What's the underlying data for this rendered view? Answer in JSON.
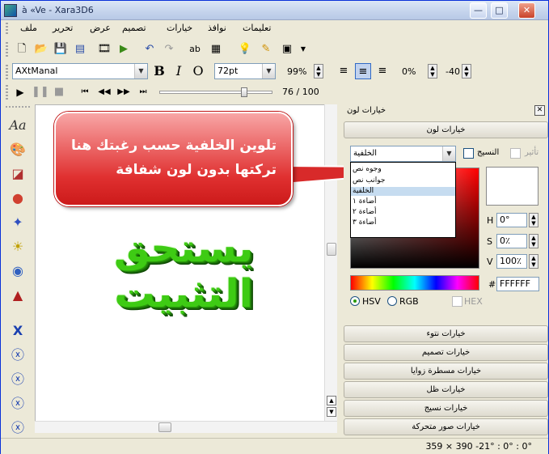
{
  "window": {
    "title": "à «Ve - Xara3D6"
  },
  "menu": {
    "items": [
      "ملف",
      "تحرير",
      "عرض",
      "تصميم",
      "خيارات",
      "نوافذ",
      "تعليمات"
    ]
  },
  "font_toolbar": {
    "font_name": "AXtManal",
    "bold": "B",
    "italic": "I",
    "outline": "O",
    "font_size": "72pt",
    "scale": "99%",
    "spacing": "0%",
    "offset": "-40"
  },
  "animation_toolbar": {
    "frame_counter": "76 / 100",
    "progress": 0.76
  },
  "canvas": {
    "text_3d": "يستحق التثبيت"
  },
  "callout": {
    "line1": "تلوين الخلفية حسب رغبتك هنا",
    "line2": "تركتها بدون لون شفافة"
  },
  "panel": {
    "title": "خيارات لون",
    "color_options_button": "خيارات لون",
    "target_select": "الخلفية",
    "target_options": [
      "وجوه نص",
      "جوانب نص",
      "الخلفية",
      "أضاءة ١",
      "أضاءة ٢",
      "أضاءة ٣"
    ],
    "selected_option_index": 2,
    "texture_label": "النسيج",
    "effect_label": "تأثير",
    "hsv": {
      "h_label": "H",
      "h": "0°",
      "s_label": "S",
      "s": "0٪",
      "v_label": "V",
      "v": "100٪"
    },
    "hex_prefix": "#",
    "hex_value": "FFFFFF",
    "radio_hsv": "HSV",
    "radio_rgb": "RGB",
    "hex_checkbox": "HEX",
    "sections": [
      "خيارات نتوء",
      "خيارات تصميم",
      "خيارات مسطرة زوايا",
      "خيارات ظل",
      "خيارات نسيج",
      "خيارات صور متحركة"
    ]
  },
  "status": {
    "text": "359 × 390  -21° : 0° : 0°"
  },
  "colors": {
    "callout_red": "#e03030",
    "text_green": "#3ecb14",
    "title_blue": "#0831d9"
  }
}
